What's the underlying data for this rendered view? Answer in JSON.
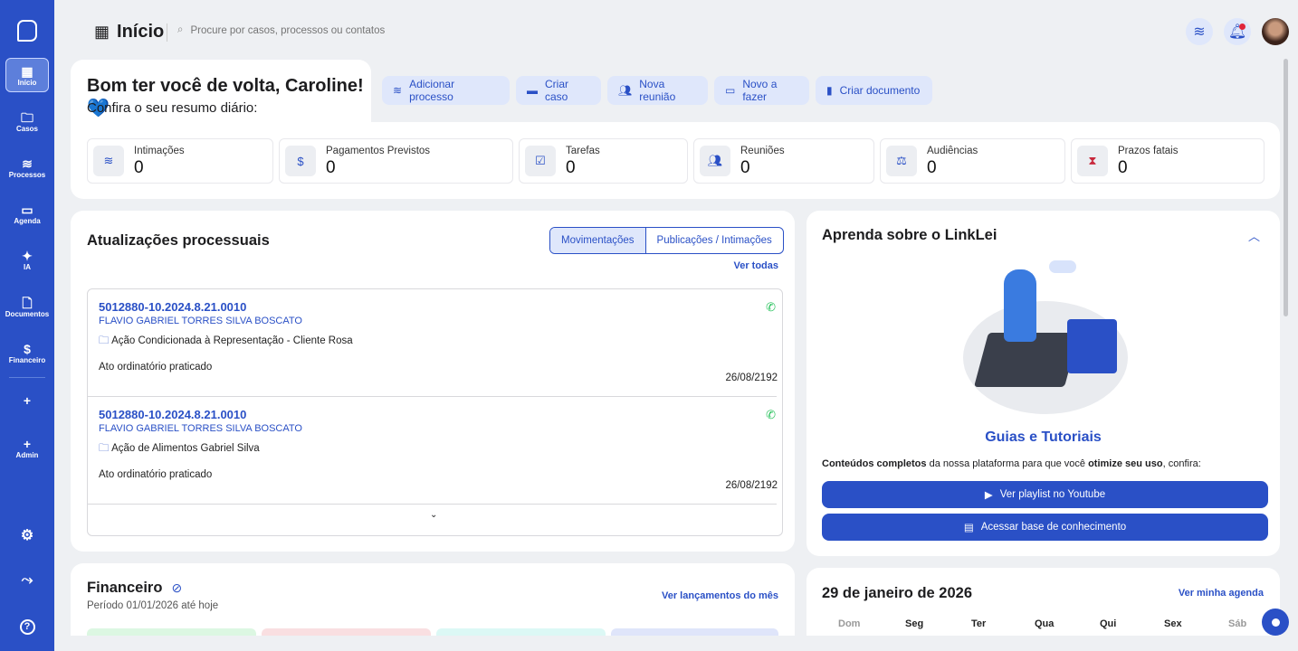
{
  "sidebar": {
    "items": [
      {
        "label": "Início",
        "icon": "grid-icon"
      },
      {
        "label": "Casos",
        "icon": "folder-icon"
      },
      {
        "label": "Processos",
        "icon": "layers-icon"
      },
      {
        "label": "Agenda",
        "icon": "calendar-icon"
      },
      {
        "label": "IA",
        "icon": "sparkles-icon"
      },
      {
        "label": "Documentos",
        "icon": "document-icon"
      },
      {
        "label": "Financeiro",
        "icon": "dollar-icon"
      },
      {
        "label": "",
        "icon": "plus-icon"
      },
      {
        "label": "Admin",
        "icon": "plus-icon"
      }
    ]
  },
  "header": {
    "title": "Início",
    "search_placeholder": "Procure por casos, processos ou contatos"
  },
  "greeting": {
    "title": "Bom ter você de volta, Caroline! 💙",
    "subtitle": "Confira o seu resumo diário:"
  },
  "actions": [
    "Adicionar processo",
    "Criar caso",
    "Nova reunião",
    "Novo a fazer",
    "Criar documento"
  ],
  "stats": [
    {
      "label": "Intimações",
      "value": "0"
    },
    {
      "label": "Pagamentos Previstos",
      "value": "0"
    },
    {
      "label": "Tarefas",
      "value": "0"
    },
    {
      "label": "Reuniões",
      "value": "0"
    },
    {
      "label": "Audiências",
      "value": "0"
    },
    {
      "label": "Prazos fatais",
      "value": "0"
    }
  ],
  "updates": {
    "title": "Atualizações processuais",
    "tabs": [
      "Movimentações",
      "Publicações / Intimações"
    ],
    "see_all": "Ver todas",
    "items": [
      {
        "number": "5012880-10.2024.8.21.0010",
        "name": "FLAVIO GABRIEL TORRES SILVA BOSCATO",
        "case": "Ação Condicionada à Representação - Cliente Rosa",
        "status": "Ato ordinatório praticado",
        "date": "26/08/2192"
      },
      {
        "number": "5012880-10.2024.8.21.0010",
        "name": "FLAVIO GABRIEL TORRES SILVA BOSCATO",
        "case": "Ação de Alimentos Gabriel Silva",
        "status": "Ato ordinatório praticado",
        "date": "26/08/2192"
      }
    ]
  },
  "learn": {
    "title": "Aprenda sobre o LinkLei",
    "subtitle": "Guias e Tutoriais",
    "desc_bold1": "Conteúdos completos",
    "desc_mid": " da nossa plataforma para que você ",
    "desc_bold2": "otimize seu uso",
    "desc_end": ", confira:",
    "btn_youtube": "Ver playlist no Youtube",
    "btn_kb": "Acessar base de conhecimento"
  },
  "finance": {
    "title": "Financeiro",
    "period": "Período 01/01/2026 até hoje",
    "link": "Ver lançamentos do mês"
  },
  "calendar": {
    "date": "29 de janeiro de 2026",
    "link": "Ver minha agenda",
    "days": [
      "Dom",
      "Seg",
      "Ter",
      "Qua",
      "Qui",
      "Sex",
      "Sáb"
    ]
  }
}
